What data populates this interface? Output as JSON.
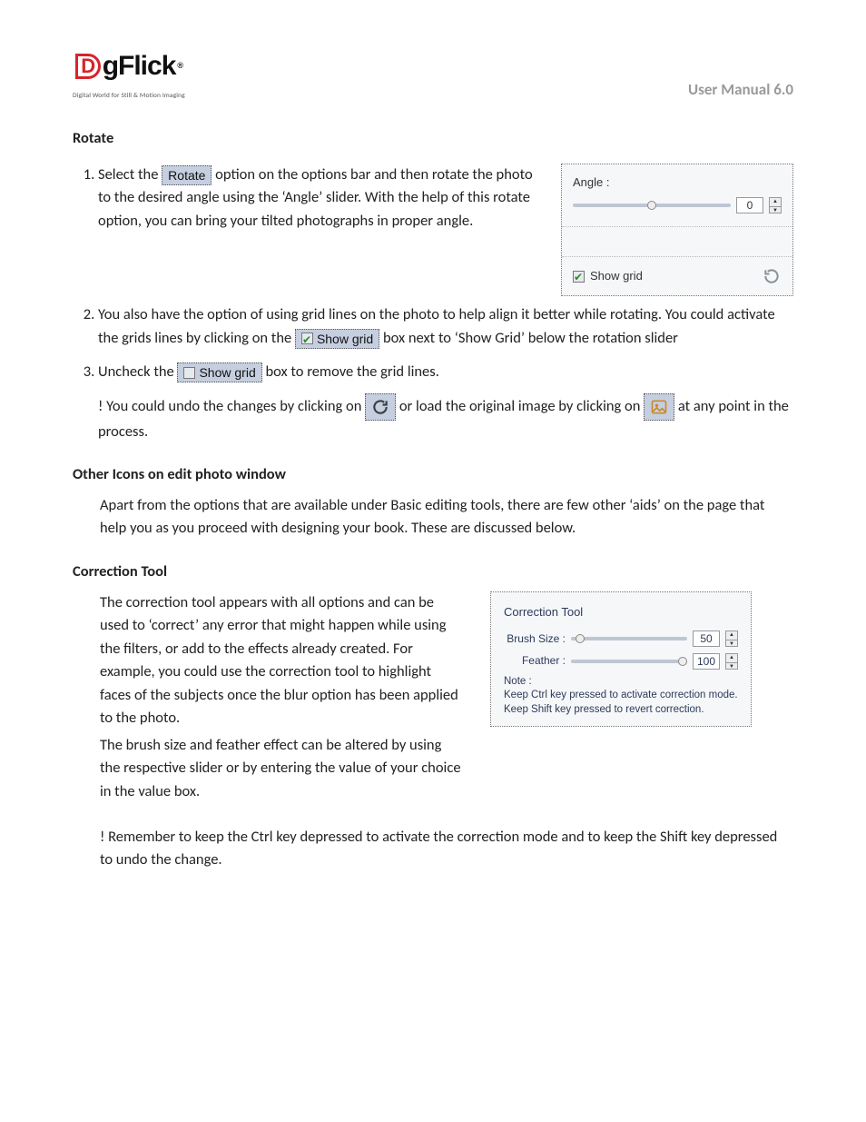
{
  "header": {
    "logo_brand_main": "gFlick",
    "logo_tagline": "Digital World for Still & Motion Imaging",
    "logo_reg": "®",
    "manual_title": "User Manual 6.0"
  },
  "rotate": {
    "heading": "Rotate",
    "item1_pre": "Select the ",
    "item1_chip": "Rotate",
    "item1_post": " option on the options bar and then rotate the photo to the desired angle using the ‘Angle’ slider. With the help of this rotate option, you can bring your tilted photographs in proper angle.",
    "item2_pre": "You also have the option of using grid lines on the photo to help align it better while rotating. You could activate the grids lines by clicking on the ",
    "item2_chip": "Show grid",
    "item2_post": " box next to ‘Show Grid’ below the rotation slider",
    "item3_pre": "Uncheck the ",
    "item3_chip": "Show grid",
    "item3_post": " box to remove the grid lines.",
    "undo_pre": "! You could undo the changes by clicking on",
    "undo_mid": " or load the original image by clicking on ",
    "undo_post": "at any point in the process."
  },
  "angle_panel": {
    "angle_label": "Angle :",
    "angle_value": "0",
    "showgrid_label": "Show grid"
  },
  "other_icons": {
    "heading": "Other Icons on edit photo window",
    "body": "Apart from the options that are available under Basic editing tools, there are few other ‘aids’ on the page that help you as you proceed with designing your book. These are discussed below."
  },
  "correction": {
    "heading": "Correction Tool",
    "p1": "The correction tool appears with all options and can be used to ‘correct’ any error that might happen while using the filters, or add to the effects already created. For example, you could use the correction tool to highlight faces of the subjects once the blur option has been applied to the photo.",
    "p2": "The brush size and feather effect can be altered by using the respective slider or by entering the value of your choice in the value box.",
    "note": "! Remember to keep the Ctrl key depressed to activate the correction mode and to keep the Shift key depressed to undo the change.",
    "panel": {
      "title": "Correction Tool",
      "brush_label": "Brush Size :",
      "brush_value": "50",
      "feather_label": "Feather :",
      "feather_value": "100",
      "note_label": "Note :",
      "note_line1": "Keep Ctrl key pressed to activate correction mode.",
      "note_line2": "Keep Shift key pressed to revert correction."
    }
  }
}
